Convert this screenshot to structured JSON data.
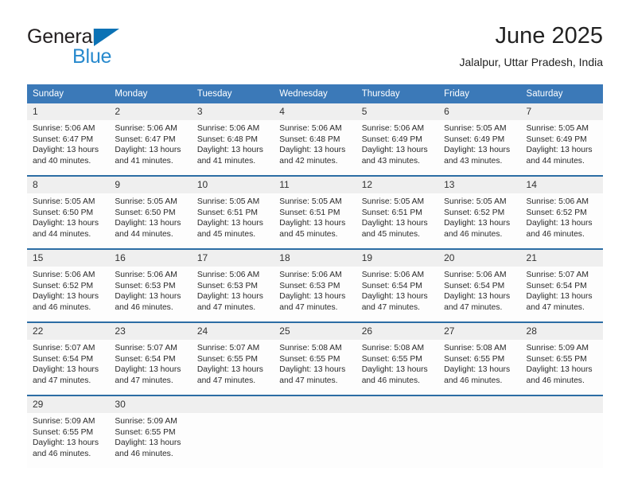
{
  "brand": {
    "name_part1": "General",
    "name_part2": "Blue",
    "triangle_color": "#0b72b5",
    "blue_color": "#2789cd"
  },
  "header": {
    "title": "June 2025",
    "subtitle": "Jalalpur, Uttar Pradesh, India"
  },
  "colors": {
    "header_blue": "#3b79b8",
    "separator_blue": "#2c6da4",
    "daynum_band": "#efefef",
    "cell_background": "#fdfdfd",
    "text": "#222222"
  },
  "weekdays": [
    "Sunday",
    "Monday",
    "Tuesday",
    "Wednesday",
    "Thursday",
    "Friday",
    "Saturday"
  ],
  "weeks": [
    [
      {
        "day": "1",
        "sunrise": "Sunrise: 5:06 AM",
        "sunset": "Sunset: 6:47 PM",
        "daylight1": "Daylight: 13 hours",
        "daylight2": "and 40 minutes."
      },
      {
        "day": "2",
        "sunrise": "Sunrise: 5:06 AM",
        "sunset": "Sunset: 6:47 PM",
        "daylight1": "Daylight: 13 hours",
        "daylight2": "and 41 minutes."
      },
      {
        "day": "3",
        "sunrise": "Sunrise: 5:06 AM",
        "sunset": "Sunset: 6:48 PM",
        "daylight1": "Daylight: 13 hours",
        "daylight2": "and 41 minutes."
      },
      {
        "day": "4",
        "sunrise": "Sunrise: 5:06 AM",
        "sunset": "Sunset: 6:48 PM",
        "daylight1": "Daylight: 13 hours",
        "daylight2": "and 42 minutes."
      },
      {
        "day": "5",
        "sunrise": "Sunrise: 5:06 AM",
        "sunset": "Sunset: 6:49 PM",
        "daylight1": "Daylight: 13 hours",
        "daylight2": "and 43 minutes."
      },
      {
        "day": "6",
        "sunrise": "Sunrise: 5:05 AM",
        "sunset": "Sunset: 6:49 PM",
        "daylight1": "Daylight: 13 hours",
        "daylight2": "and 43 minutes."
      },
      {
        "day": "7",
        "sunrise": "Sunrise: 5:05 AM",
        "sunset": "Sunset: 6:49 PM",
        "daylight1": "Daylight: 13 hours",
        "daylight2": "and 44 minutes."
      }
    ],
    [
      {
        "day": "8",
        "sunrise": "Sunrise: 5:05 AM",
        "sunset": "Sunset: 6:50 PM",
        "daylight1": "Daylight: 13 hours",
        "daylight2": "and 44 minutes."
      },
      {
        "day": "9",
        "sunrise": "Sunrise: 5:05 AM",
        "sunset": "Sunset: 6:50 PM",
        "daylight1": "Daylight: 13 hours",
        "daylight2": "and 44 minutes."
      },
      {
        "day": "10",
        "sunrise": "Sunrise: 5:05 AM",
        "sunset": "Sunset: 6:51 PM",
        "daylight1": "Daylight: 13 hours",
        "daylight2": "and 45 minutes."
      },
      {
        "day": "11",
        "sunrise": "Sunrise: 5:05 AM",
        "sunset": "Sunset: 6:51 PM",
        "daylight1": "Daylight: 13 hours",
        "daylight2": "and 45 minutes."
      },
      {
        "day": "12",
        "sunrise": "Sunrise: 5:05 AM",
        "sunset": "Sunset: 6:51 PM",
        "daylight1": "Daylight: 13 hours",
        "daylight2": "and 45 minutes."
      },
      {
        "day": "13",
        "sunrise": "Sunrise: 5:05 AM",
        "sunset": "Sunset: 6:52 PM",
        "daylight1": "Daylight: 13 hours",
        "daylight2": "and 46 minutes."
      },
      {
        "day": "14",
        "sunrise": "Sunrise: 5:06 AM",
        "sunset": "Sunset: 6:52 PM",
        "daylight1": "Daylight: 13 hours",
        "daylight2": "and 46 minutes."
      }
    ],
    [
      {
        "day": "15",
        "sunrise": "Sunrise: 5:06 AM",
        "sunset": "Sunset: 6:52 PM",
        "daylight1": "Daylight: 13 hours",
        "daylight2": "and 46 minutes."
      },
      {
        "day": "16",
        "sunrise": "Sunrise: 5:06 AM",
        "sunset": "Sunset: 6:53 PM",
        "daylight1": "Daylight: 13 hours",
        "daylight2": "and 46 minutes."
      },
      {
        "day": "17",
        "sunrise": "Sunrise: 5:06 AM",
        "sunset": "Sunset: 6:53 PM",
        "daylight1": "Daylight: 13 hours",
        "daylight2": "and 47 minutes."
      },
      {
        "day": "18",
        "sunrise": "Sunrise: 5:06 AM",
        "sunset": "Sunset: 6:53 PM",
        "daylight1": "Daylight: 13 hours",
        "daylight2": "and 47 minutes."
      },
      {
        "day": "19",
        "sunrise": "Sunrise: 5:06 AM",
        "sunset": "Sunset: 6:54 PM",
        "daylight1": "Daylight: 13 hours",
        "daylight2": "and 47 minutes."
      },
      {
        "day": "20",
        "sunrise": "Sunrise: 5:06 AM",
        "sunset": "Sunset: 6:54 PM",
        "daylight1": "Daylight: 13 hours",
        "daylight2": "and 47 minutes."
      },
      {
        "day": "21",
        "sunrise": "Sunrise: 5:07 AM",
        "sunset": "Sunset: 6:54 PM",
        "daylight1": "Daylight: 13 hours",
        "daylight2": "and 47 minutes."
      }
    ],
    [
      {
        "day": "22",
        "sunrise": "Sunrise: 5:07 AM",
        "sunset": "Sunset: 6:54 PM",
        "daylight1": "Daylight: 13 hours",
        "daylight2": "and 47 minutes."
      },
      {
        "day": "23",
        "sunrise": "Sunrise: 5:07 AM",
        "sunset": "Sunset: 6:54 PM",
        "daylight1": "Daylight: 13 hours",
        "daylight2": "and 47 minutes."
      },
      {
        "day": "24",
        "sunrise": "Sunrise: 5:07 AM",
        "sunset": "Sunset: 6:55 PM",
        "daylight1": "Daylight: 13 hours",
        "daylight2": "and 47 minutes."
      },
      {
        "day": "25",
        "sunrise": "Sunrise: 5:08 AM",
        "sunset": "Sunset: 6:55 PM",
        "daylight1": "Daylight: 13 hours",
        "daylight2": "and 47 minutes."
      },
      {
        "day": "26",
        "sunrise": "Sunrise: 5:08 AM",
        "sunset": "Sunset: 6:55 PM",
        "daylight1": "Daylight: 13 hours",
        "daylight2": "and 46 minutes."
      },
      {
        "day": "27",
        "sunrise": "Sunrise: 5:08 AM",
        "sunset": "Sunset: 6:55 PM",
        "daylight1": "Daylight: 13 hours",
        "daylight2": "and 46 minutes."
      },
      {
        "day": "28",
        "sunrise": "Sunrise: 5:09 AM",
        "sunset": "Sunset: 6:55 PM",
        "daylight1": "Daylight: 13 hours",
        "daylight2": "and 46 minutes."
      }
    ],
    [
      {
        "day": "29",
        "sunrise": "Sunrise: 5:09 AM",
        "sunset": "Sunset: 6:55 PM",
        "daylight1": "Daylight: 13 hours",
        "daylight2": "and 46 minutes."
      },
      {
        "day": "30",
        "sunrise": "Sunrise: 5:09 AM",
        "sunset": "Sunset: 6:55 PM",
        "daylight1": "Daylight: 13 hours",
        "daylight2": "and 46 minutes."
      },
      {
        "day": "",
        "sunrise": "",
        "sunset": "",
        "daylight1": "",
        "daylight2": ""
      },
      {
        "day": "",
        "sunrise": "",
        "sunset": "",
        "daylight1": "",
        "daylight2": ""
      },
      {
        "day": "",
        "sunrise": "",
        "sunset": "",
        "daylight1": "",
        "daylight2": ""
      },
      {
        "day": "",
        "sunrise": "",
        "sunset": "",
        "daylight1": "",
        "daylight2": ""
      },
      {
        "day": "",
        "sunrise": "",
        "sunset": "",
        "daylight1": "",
        "daylight2": ""
      }
    ]
  ]
}
